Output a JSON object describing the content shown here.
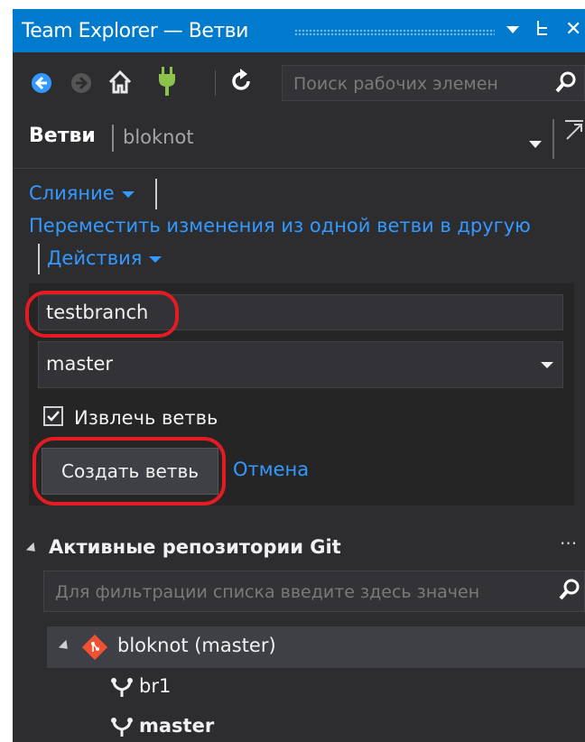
{
  "window": {
    "title": "Team Explorer — Ветви",
    "dropdown_icon": "chevron-down-icon",
    "pin_icon": "pin-icon",
    "close_icon": "close-icon",
    "pin_glyph": "ᖶ",
    "close_glyph": "✕"
  },
  "toolbar": {
    "icons": [
      "back-icon",
      "forward-icon",
      "home-icon",
      "connect-icon",
      "refresh-icon"
    ],
    "search_placeholder": "Поиск рабочих элемен",
    "search_icon": "search-icon"
  },
  "header": {
    "title": "Ветви",
    "repo": "bloknot"
  },
  "actions": {
    "merge_label": "Слияние",
    "move_changes_label": "Переместить изменения из одной ветви в другую",
    "actions_label": "Действия"
  },
  "new_branch_form": {
    "branch_name_value": "testbranch",
    "source_branch_value": "master",
    "checkout_label": "Извлечь ветвь",
    "checkout_checked": true,
    "create_button_label": "Создать ветвь",
    "cancel_label": "Отмена"
  },
  "repositories": {
    "section_title": "Активные репозитории Git",
    "more_label": "···",
    "filter_placeholder": "Для фильтрации списка введите здесь значен",
    "repo_label": "bloknot (master)",
    "branches": [
      {
        "name": "br1",
        "bold": false
      },
      {
        "name": "master",
        "bold": true
      }
    ]
  },
  "colors": {
    "accent": "#007acc",
    "link": "#3399ff",
    "highlight_oval": "#e31b23",
    "git_icon": "#f05133"
  }
}
